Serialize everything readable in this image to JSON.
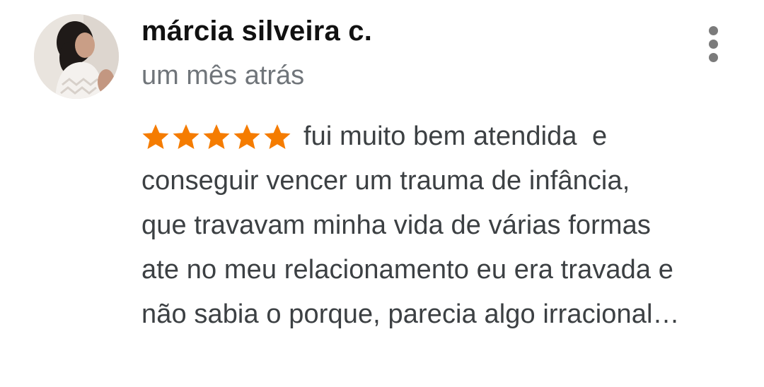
{
  "review": {
    "author_name": "márcia silveira c.",
    "timestamp": "um mês atrás",
    "rating": 5,
    "rating_max": 5,
    "star_color": "#f57c00",
    "more_icon": "more-vert-icon",
    "text_lines": [
      "fui muito bem atendida  e",
      "conseguir vencer um trauma de infância,",
      "que travavam minha vida de várias formas",
      "ate no meu relacionamento eu era travada e",
      "não sabia o porque, parecia algo irracional…"
    ]
  }
}
